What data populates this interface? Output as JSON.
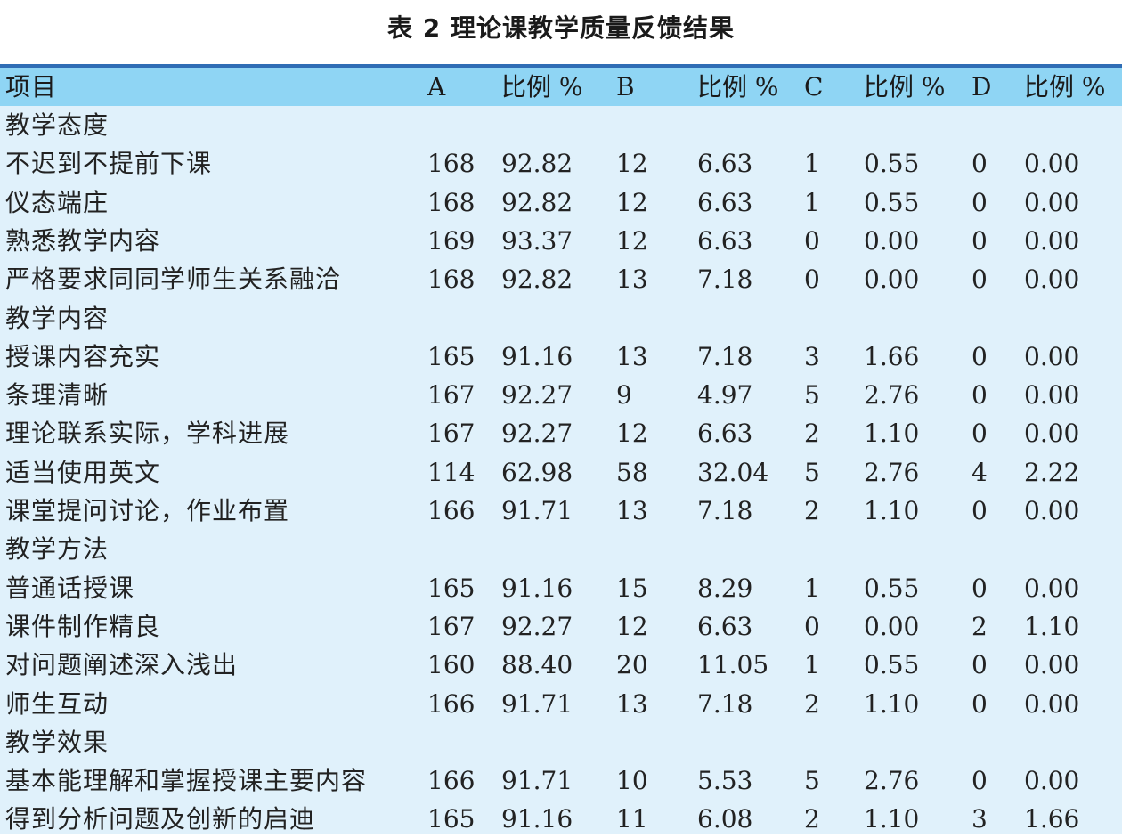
{
  "title": "表 2  理论课教学质量反馈结果",
  "header": {
    "item": "项目",
    "a": "A",
    "pa": "比例 %",
    "b": "B",
    "pb": "比例 %",
    "c": "C",
    "pc": "比例 %",
    "d": "D",
    "pd": "比例 %"
  },
  "rows": [
    {
      "item": "教学态度",
      "a": "",
      "pa": "",
      "b": "",
      "pb": "",
      "c": "",
      "pc": "",
      "d": "",
      "pd": ""
    },
    {
      "item": "不迟到不提前下课",
      "a": "168",
      "pa": "92.82",
      "b": "12",
      "pb": "6.63",
      "c": "1",
      "pc": "0.55",
      "d": "0",
      "pd": "0.00"
    },
    {
      "item": "仪态端庄",
      "a": "168",
      "pa": "92.82",
      "b": "12",
      "pb": "6.63",
      "c": "1",
      "pc": "0.55",
      "d": "0",
      "pd": "0.00"
    },
    {
      "item": "熟悉教学内容",
      "a": "169",
      "pa": "93.37",
      "b": "12",
      "pb": "6.63",
      "c": "0",
      "pc": "0.00",
      "d": "0",
      "pd": "0.00"
    },
    {
      "item": "严格要求同同学师生关系融洽",
      "a": "168",
      "pa": "92.82",
      "b": "13",
      "pb": "7.18",
      "c": "0",
      "pc": "0.00",
      "d": "0",
      "pd": "0.00"
    },
    {
      "item": "教学内容",
      "a": "",
      "pa": "",
      "b": "",
      "pb": "",
      "c": "",
      "pc": "",
      "d": "",
      "pd": ""
    },
    {
      "item": "授课内容充实",
      "a": "165",
      "pa": "91.16",
      "b": "13",
      "pb": "7.18",
      "c": "3",
      "pc": "1.66",
      "d": "0",
      "pd": "0.00"
    },
    {
      "item": "条理清晰",
      "a": "167",
      "pa": "92.27",
      "b": "9",
      "pb": "4.97",
      "c": "5",
      "pc": "2.76",
      "d": "0",
      "pd": "0.00"
    },
    {
      "item": "理论联系实际，学科进展",
      "a": "167",
      "pa": "92.27",
      "b": "12",
      "pb": "6.63",
      "c": "2",
      "pc": "1.10",
      "d": "0",
      "pd": "0.00"
    },
    {
      "item": "适当使用英文",
      "a": "114",
      "pa": "62.98",
      "b": "58",
      "pb": "32.04",
      "c": "5",
      "pc": "2.76",
      "d": "4",
      "pd": "2.22"
    },
    {
      "item": "课堂提问讨论，作业布置",
      "a": "166",
      "pa": "91.71",
      "b": "13",
      "pb": "7.18",
      "c": "2",
      "pc": "1.10",
      "d": "0",
      "pd": "0.00"
    },
    {
      "item": "教学方法",
      "a": "",
      "pa": "",
      "b": "",
      "pb": "",
      "c": "",
      "pc": "",
      "d": "",
      "pd": ""
    },
    {
      "item": "普通话授课",
      "a": "165",
      "pa": "91.16",
      "b": "15",
      "pb": "8.29",
      "c": "1",
      "pc": "0.55",
      "d": "0",
      "pd": "0.00"
    },
    {
      "item": "课件制作精良",
      "a": "167",
      "pa": "92.27",
      "b": "12",
      "pb": "6.63",
      "c": "0",
      "pc": "0.00",
      "d": "2",
      "pd": "1.10"
    },
    {
      "item": "对问题阐述深入浅出",
      "a": "160",
      "pa": "88.40",
      "b": "20",
      "pb": "11.05",
      "c": "1",
      "pc": "0.55",
      "d": "0",
      "pd": "0.00"
    },
    {
      "item": "师生互动",
      "a": "166",
      "pa": "91.71",
      "b": "13",
      "pb": "7.18",
      "c": "2",
      "pc": "1.10",
      "d": "0",
      "pd": "0.00"
    },
    {
      "item": "教学效果",
      "a": "",
      "pa": "",
      "b": "",
      "pb": "",
      "c": "",
      "pc": "",
      "d": "",
      "pd": ""
    },
    {
      "item": "基本能理解和掌握授课主要内容",
      "a": "166",
      "pa": "91.71",
      "b": "10",
      "pb": "5.53",
      "c": "5",
      "pc": "2.76",
      "d": "0",
      "pd": "0.00"
    },
    {
      "item": "得到分析问题及创新的启迪",
      "a": "165",
      "pa": "91.16",
      "b": "11",
      "pb": "6.08",
      "c": "2",
      "pc": "1.10",
      "d": "3",
      "pd": "1.66"
    }
  ]
}
